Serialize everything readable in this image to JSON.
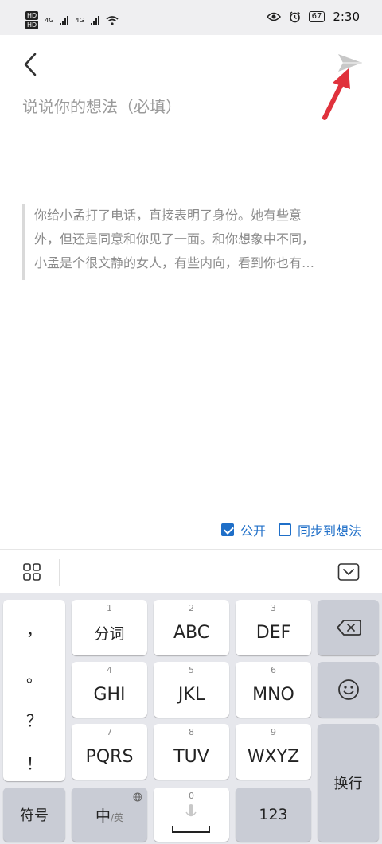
{
  "status_bar": {
    "hd": "HD",
    "net": "4G",
    "battery": "67",
    "time": "2:30"
  },
  "editor": {
    "placeholder": "说说你的想法（必填）",
    "quote_lines": [
      "你给小孟打了电话，直接表明了身份。她有些意",
      "外，但还是同意和你见了一面。和你想象中不同，",
      "小孟是个很文静的女人，有些内向，看到你也有…"
    ]
  },
  "options": {
    "public_label": "公开",
    "public_checked": true,
    "sync_label": "同步到想法",
    "sync_checked": false
  },
  "keyboard": {
    "punctuation": [
      "，",
      "。",
      "？",
      "！"
    ],
    "keys": [
      {
        "num": "1",
        "label": "分词"
      },
      {
        "num": "2",
        "label": "ABC"
      },
      {
        "num": "3",
        "label": "DEF"
      },
      {
        "num": "4",
        "label": "GHI"
      },
      {
        "num": "5",
        "label": "JKL"
      },
      {
        "num": "6",
        "label": "MNO"
      },
      {
        "num": "7",
        "label": "PQRS"
      },
      {
        "num": "8",
        "label": "TUV"
      },
      {
        "num": "9",
        "label": "WXYZ"
      }
    ],
    "symbols_label": "符号",
    "lang_main": "中",
    "lang_alt": "/英",
    "space_num": "0",
    "num_label": "123",
    "enter_label": "换行"
  },
  "colors": {
    "accent": "#1f6fc8",
    "annotation_arrow": "#e0323c"
  }
}
